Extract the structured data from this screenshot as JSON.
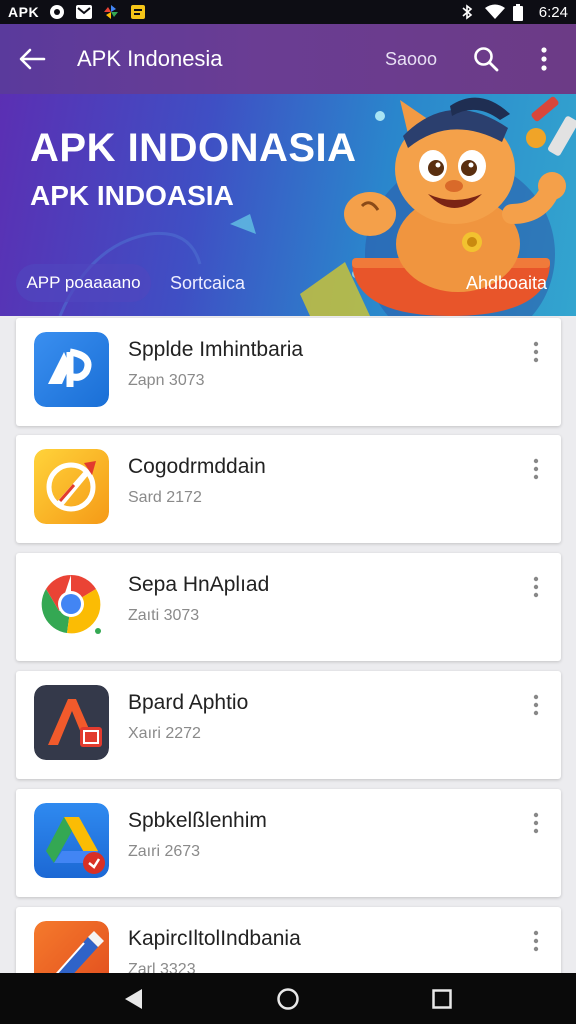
{
  "status_bar": {
    "app_label": "APK",
    "time": "6:24",
    "icons": [
      "circle-logo-icon",
      "mail-icon",
      "pinwheel-icon",
      "note-icon",
      "bluetooth-icon",
      "wifi-icon",
      "battery-icon"
    ]
  },
  "app_bar": {
    "title": "APK Indonesia",
    "search_label": "Saooo",
    "icons": [
      "back-arrow-icon",
      "search-icon",
      "more-vert-icon"
    ]
  },
  "banner": {
    "title": "APK INDONASIA",
    "subtitle": "APK INDOASIA",
    "tabs": [
      "APP poaaaano",
      "Sortcaica"
    ],
    "right_label": "Ahdboaita"
  },
  "apps": [
    {
      "name": "Spplde Imhintbaria",
      "meta": "Zapn 3073",
      "icon": "blue-ap-icon"
    },
    {
      "name": "Cogodrmddain",
      "meta": "Sard 2172",
      "icon": "yellow-rocket-icon"
    },
    {
      "name": "Sepa HnAplıad",
      "meta": "Zaıti 3073",
      "icon": "chrome-icon"
    },
    {
      "name": "Bpard Aphtio",
      "meta": "Xaıri 2272",
      "icon": "adobe-a-icon"
    },
    {
      "name": "Spbkelßlenhim",
      "meta": "Zaıri 2673",
      "icon": "drive-icon"
    },
    {
      "name": "KapircIltolIndbania",
      "meta": "Zarl 3323",
      "icon": "orange-pen-icon"
    }
  ],
  "colors": {
    "app_bar": "#62399a",
    "banner_start": "#5b2fb3",
    "banner_end": "#33a5cf",
    "card_bg": "#ffffff",
    "list_bg": "#ececef"
  }
}
